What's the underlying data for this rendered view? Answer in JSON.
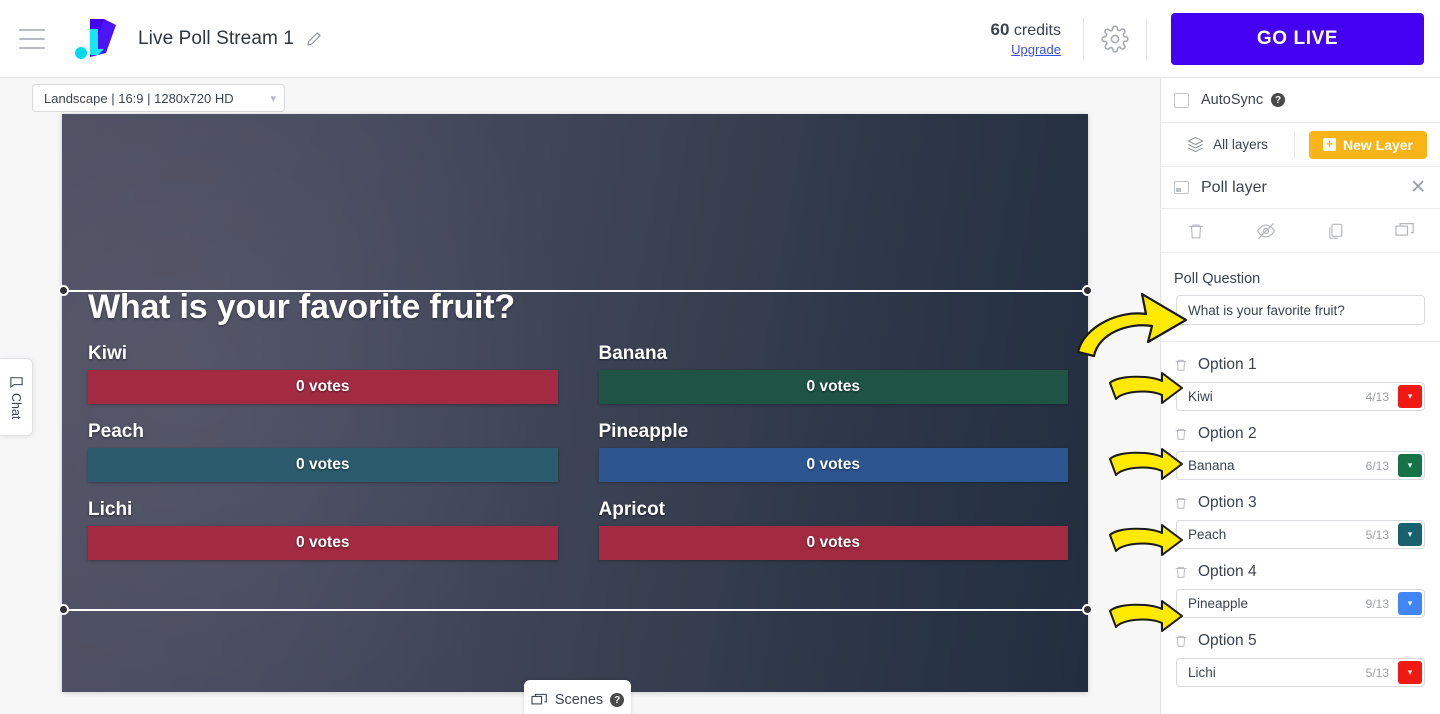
{
  "header": {
    "menu_icon": "hamburger-icon",
    "logo": "brand-logo",
    "project_title": "Live Poll Stream 1",
    "edit_icon": "pencil-icon",
    "credits_value": "60",
    "credits_label": "credits",
    "upgrade_label": "Upgrade",
    "settings_icon": "gear-icon",
    "go_live_label": "GO LIVE",
    "accent_color": "#4400f0"
  },
  "editor": {
    "ratio_select_value": "Landscape | 16:9 | 1280x720 HD",
    "chevron_icon": "chevron-down-icon",
    "chat_tab_label": "Chat",
    "chat_icon": "chat-bubble-icon",
    "scenes_label": "Scenes",
    "scenes_icon": "scenes-icon",
    "scenes_help_icon": "help-icon"
  },
  "poll_preview": {
    "question": "What is your favorite fruit?",
    "options": [
      {
        "label": "Kiwi",
        "votes_text": "0 votes",
        "bar_color": "#a22b42",
        "column": "left"
      },
      {
        "label": "Banana",
        "votes_text": "0 votes",
        "bar_color": "#1f5344",
        "column": "right"
      },
      {
        "label": "Peach",
        "votes_text": "0 votes",
        "bar_color": "#2b5b6c",
        "column": "left"
      },
      {
        "label": "Pineapple",
        "votes_text": "0 votes",
        "bar_color": "#2d5691",
        "column": "right"
      },
      {
        "label": "Lichi",
        "votes_text": "0 votes",
        "bar_color": "#a22b42",
        "column": "left"
      },
      {
        "label": "Apricot",
        "votes_text": "0 votes",
        "bar_color": "#a22b42",
        "column": "right"
      }
    ]
  },
  "sidebar": {
    "autosync_label": "AutoSync",
    "autosync_checked": false,
    "autosync_help_icon": "help-icon",
    "all_layers_label": "All layers",
    "all_layers_icon": "layers-icon",
    "new_layer_label": "New Layer",
    "new_layer_color": "#f9b417",
    "layer_title": "Poll layer",
    "layer_icon": "layer-thumbnail-icon",
    "close_icon": "close-icon",
    "tools": [
      {
        "name": "delete-layer-icon"
      },
      {
        "name": "hide-layer-icon"
      },
      {
        "name": "duplicate-layer-icon"
      },
      {
        "name": "send-to-scene-icon"
      }
    ],
    "poll_question_label": "Poll Question",
    "poll_question_value": "What is your favorite fruit?",
    "options": [
      {
        "heading": "Option 1",
        "name": "Kiwi",
        "count": "4/13",
        "color": "#f01a13",
        "delete_icon": "trash-icon",
        "chevron_icon": "chevron-down-icon"
      },
      {
        "heading": "Option 2",
        "name": "Banana",
        "count": "6/13",
        "color": "#157347",
        "delete_icon": "trash-icon",
        "chevron_icon": "chevron-down-icon"
      },
      {
        "heading": "Option 3",
        "name": "Peach",
        "count": "5/13",
        "color": "#18616f",
        "delete_icon": "trash-icon",
        "chevron_icon": "chevron-down-icon"
      },
      {
        "heading": "Option 4",
        "name": "Pineapple",
        "count": "9/13",
        "color": "#4285f4",
        "delete_icon": "trash-icon",
        "chevron_icon": "chevron-down-icon"
      },
      {
        "heading": "Option 5",
        "name": "Lichi",
        "count": "5/13",
        "color": "#f01a13",
        "delete_icon": "trash-icon",
        "chevron_icon": "chevron-down-icon"
      }
    ]
  },
  "annotations": {
    "arrow_color": "#ffeb00",
    "arrows": [
      {
        "name": "arrow-to-poll-question",
        "target": "poll-question-input"
      },
      {
        "name": "arrow-to-option-1",
        "target": "option-1-name"
      },
      {
        "name": "arrow-to-option-2",
        "target": "option-2-name"
      },
      {
        "name": "arrow-to-option-3",
        "target": "option-3-name"
      },
      {
        "name": "arrow-to-option-4",
        "target": "option-4-name"
      }
    ]
  }
}
